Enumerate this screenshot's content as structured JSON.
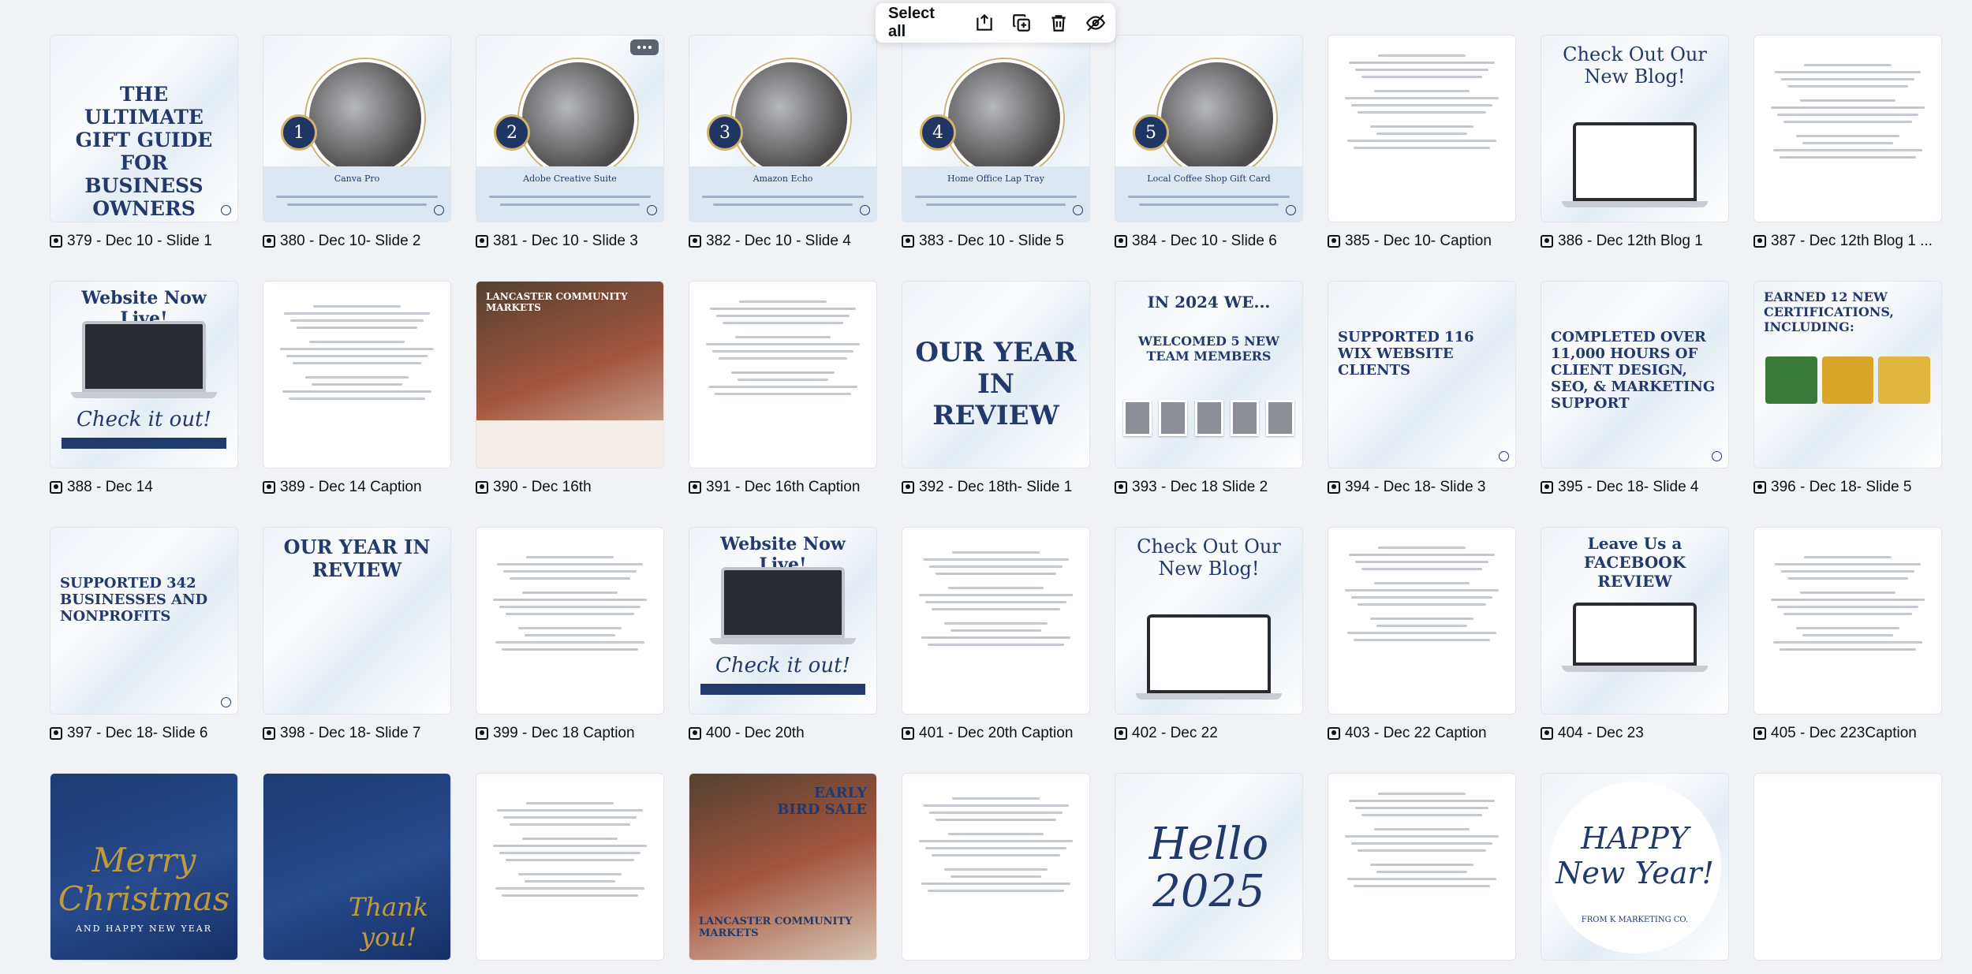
{
  "toolbar": {
    "select_all": "Select all",
    "icons": [
      "add-to-folder-icon",
      "duplicate-icon",
      "trash-icon",
      "hide-icon"
    ]
  },
  "thumbnails": [
    {
      "label": "379 - Dec 10 - Slide 1",
      "title": "THE ULTIMATE GIFT GUIDE FOR BUSINESS OWNERS"
    },
    {
      "label": "380 - Dec 10- Slide 2",
      "title": "Canva Pro",
      "number": "1"
    },
    {
      "label": "381 - Dec 10 - Slide 3",
      "title": "Adobe Creative Suite",
      "number": "2"
    },
    {
      "label": "382 - Dec 10 - Slide 4",
      "title": "Amazon Echo",
      "number": "3"
    },
    {
      "label": "383 - Dec 10 - Slide 5",
      "title": "Home Office Lap Tray",
      "number": "4"
    },
    {
      "label": "384 - Dec 10 - Slide 6",
      "title": "Local Coffee Shop Gift Card",
      "number": "5"
    },
    {
      "label": "385 - Dec 10- Caption"
    },
    {
      "label": "386 - Dec 12th Blog 1",
      "title": "Check Out Our New Blog!"
    },
    {
      "label": "387 - Dec 12th  Blog 1 ..."
    },
    {
      "label": "388 - Dec 14",
      "title": "Website Now Live!",
      "subtitle": "Check it out!"
    },
    {
      "label": "389 - Dec 14 Caption"
    },
    {
      "label": "390 - Dec 16th",
      "title": "LANCASTER COMMUNITY MARKETS"
    },
    {
      "label": "391 - Dec 16th Caption"
    },
    {
      "label": "392 - Dec 18th- Slide 1",
      "title": "OUR YEAR IN REVIEW"
    },
    {
      "label": "393 - Dec 18 Slide 2",
      "title": "IN 2024 WE...",
      "subtitle": "WELCOMED 5 NEW TEAM MEMBERS"
    },
    {
      "label": "394 - Dec 18- Slide 3",
      "title": "SUPPORTED 116 WIX WEBSITE CLIENTS"
    },
    {
      "label": "395 - Dec 18- Slide 4",
      "title": "COMPLETED OVER 11,000 HOURS OF CLIENT DESIGN, SEO, & MARKETING SUPPORT"
    },
    {
      "label": "396 - Dec 18- Slide 5",
      "title": "EARNED 12 NEW CERTIFICATIONS, INCLUDING:"
    },
    {
      "label": "397 - Dec 18- Slide 6",
      "title": "SUPPORTED 342 BUSINESSES AND NONPROFITS"
    },
    {
      "label": "398 - Dec 18- Slide 7",
      "title": "OUR YEAR IN REVIEW"
    },
    {
      "label": "399 - Dec 18 Caption"
    },
    {
      "label": "400 - Dec 20th",
      "title": "Website Now Live!",
      "subtitle": "Check it out!"
    },
    {
      "label": "401 - Dec 20th Caption"
    },
    {
      "label": "402 - Dec 22",
      "title": "Check Out Our New Blog!"
    },
    {
      "label": "403 - Dec 22 Caption"
    },
    {
      "label": "404 - Dec 23",
      "title": "Leave Us a FACEBOOK REVIEW"
    },
    {
      "label": "405 - Dec 223Caption"
    },
    {
      "label": "",
      "title": "Merry Christmas",
      "subtitle": "AND HAPPY NEW YEAR"
    },
    {
      "label": "",
      "title": "Thank you!"
    },
    {
      "label": ""
    },
    {
      "label": "",
      "title": "EARLY BIRD SALE",
      "subtitle": "LANCASTER COMMUNITY MARKETS"
    },
    {
      "label": ""
    },
    {
      "label": "",
      "title": "Hello 2025"
    },
    {
      "label": ""
    },
    {
      "label": "",
      "title": "HAPPY New Year!",
      "subtitle": "FROM K MARKETING CO."
    },
    {
      "label": ""
    }
  ]
}
